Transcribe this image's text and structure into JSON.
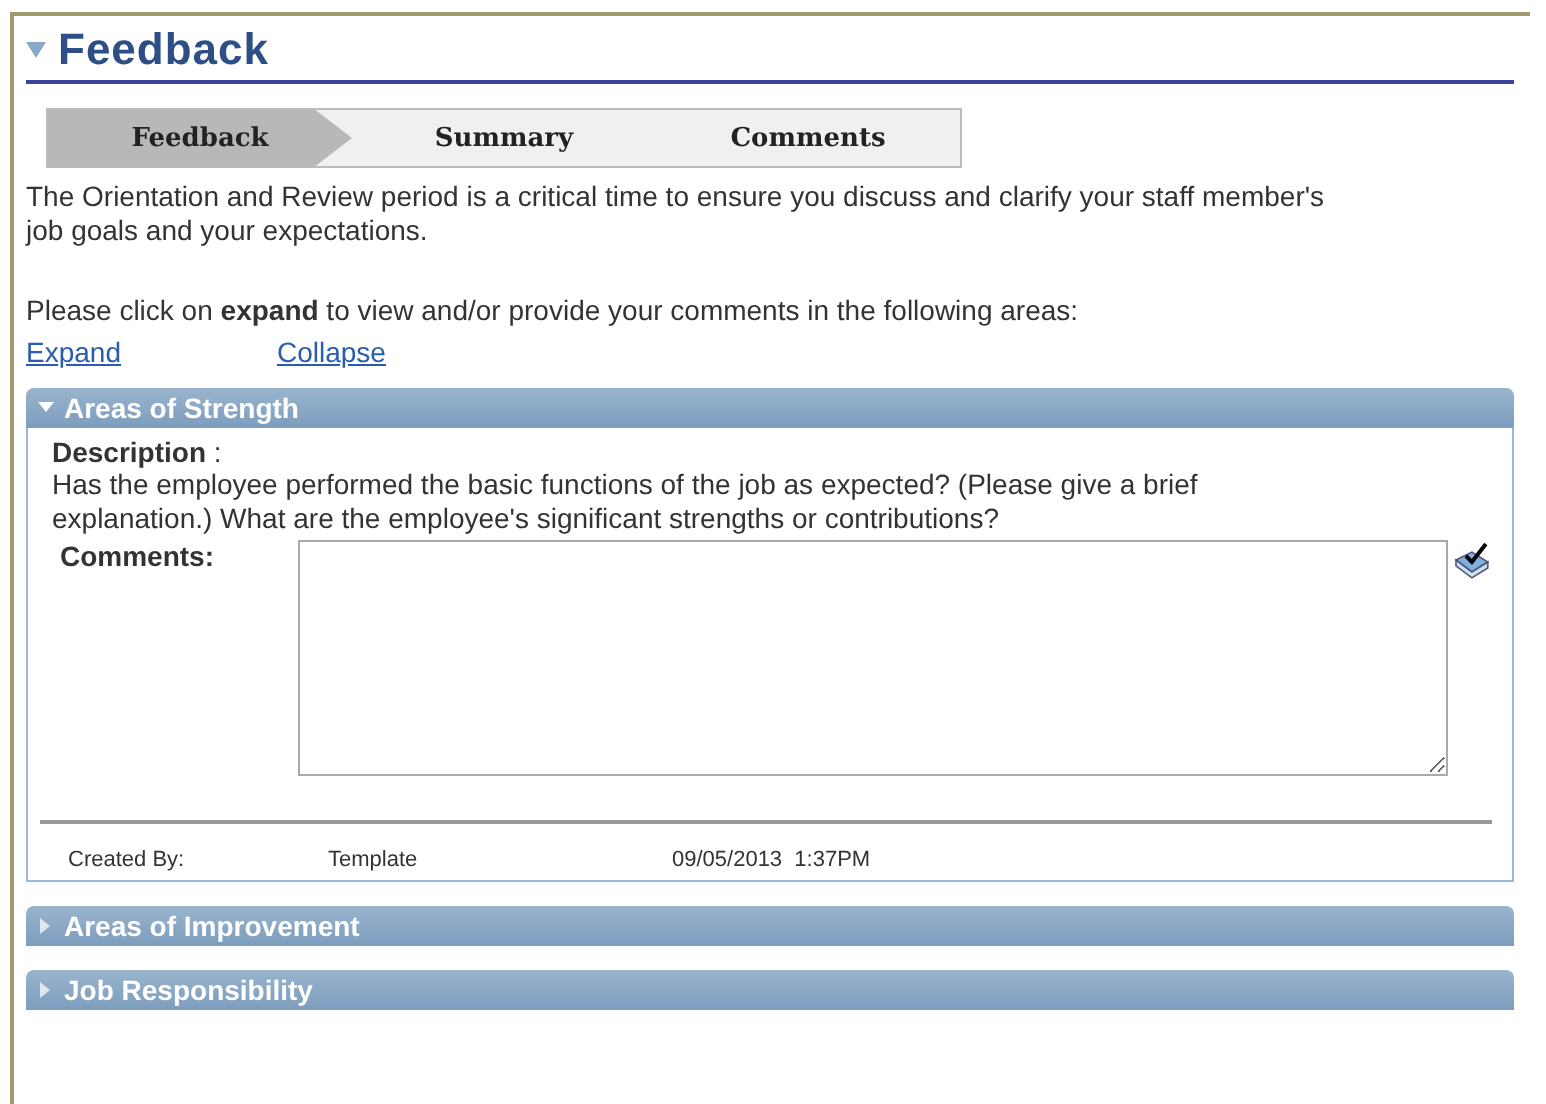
{
  "page_title": "Feedback",
  "steps": [
    {
      "label": "Feedback",
      "selected": true
    },
    {
      "label": "Summary",
      "selected": false
    },
    {
      "label": "Comments",
      "selected": false
    }
  ],
  "intro": "The Orientation and Review period is a critical time to ensure you discuss and clarify your staff member's job goals and your expectations.",
  "instruction": "Please click on **expand** to view and/or provide your comments in the following areas:",
  "links": [
    "Expand",
    "Collapse"
  ],
  "sections": [
    {
      "title": "Areas of Strength",
      "expanded": true,
      "description_label": "Description",
      "description_sep": ":",
      "description": "Has the employee performed the basic functions of the job as expected? (Please give a brief explanation.) What are the employee's significant strengths or contributions?",
      "comments_label": "Comments:",
      "created_by_label": "Created By:",
      "created_by": "Template",
      "created_at": "09/05/2013  1:37PM"
    },
    {
      "title": "Areas of Improvement",
      "expanded": false
    },
    {
      "title": "Job Responsibility",
      "expanded": false
    }
  ]
}
